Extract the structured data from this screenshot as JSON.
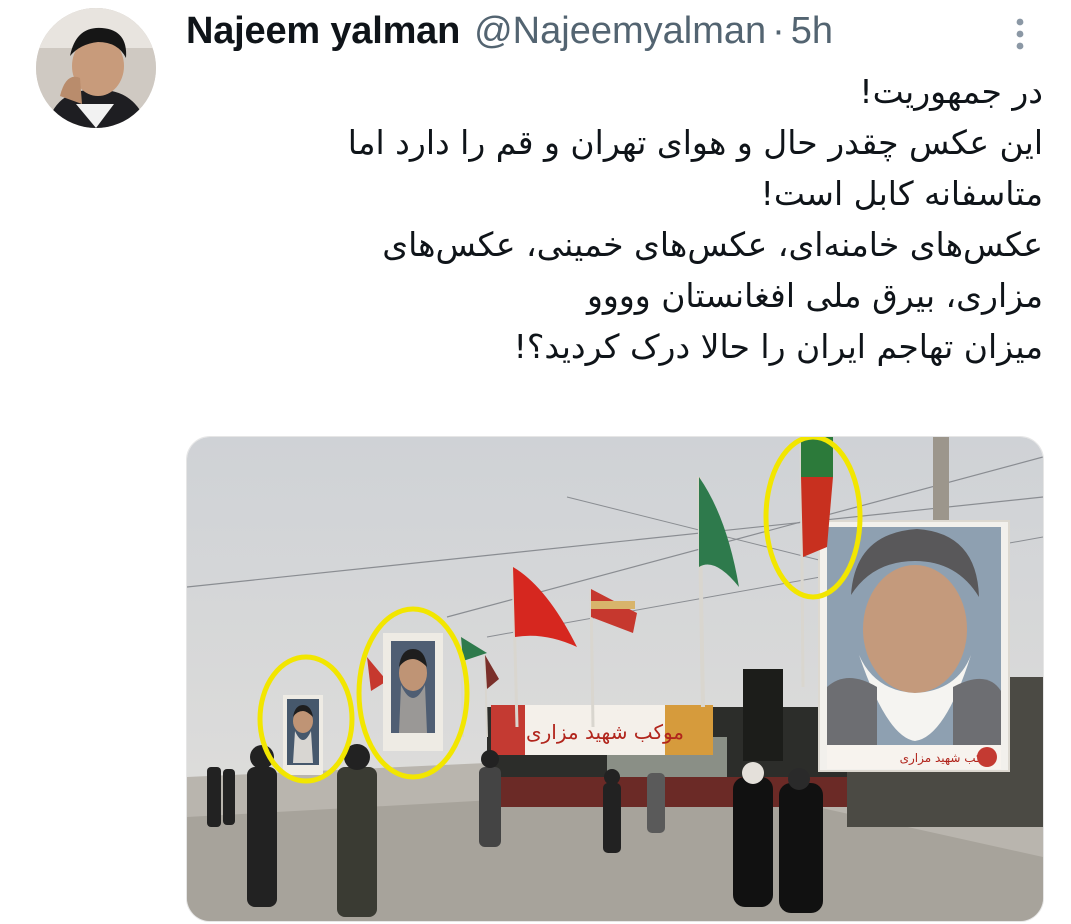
{
  "tweet": {
    "author_name": "Najeem yalman",
    "handle": "@Najeemyalman",
    "separator": "·",
    "time": "5h",
    "text_lines": [
      "در جمهوریت!",
      "این عکس چقدر حال و هوای تهران و قم را دارد اما",
      "متاسفانه کابل است!",
      "عکس‌های خامنه‌ای، عکس‌های خمینی، عکس‌های",
      "مزاری، بیرق ملی افغانستان وووو",
      "میزان تهاجم ایران را حالا درک کردید؟!"
    ]
  },
  "media": {
    "banner_left_text": "موکب شهید مزاری",
    "banner_right_text": "موکب شهید مزاری",
    "highlight_color": "#f2e600"
  },
  "icons": {
    "more": "more-vertical-icon",
    "avatar": "avatar"
  }
}
